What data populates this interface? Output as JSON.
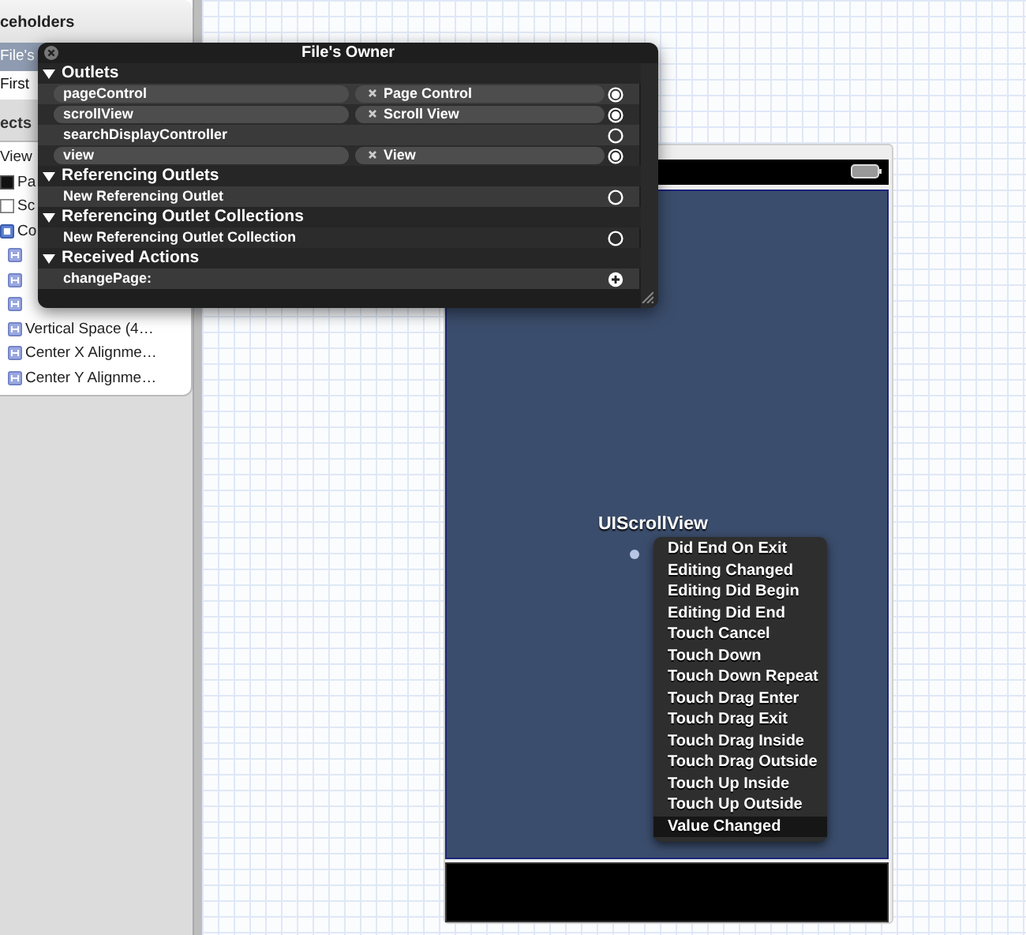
{
  "sidebar": {
    "placeholders_header": "ceholders",
    "placeholders": [
      {
        "label": "File's",
        "selected": true
      },
      {
        "label": "First",
        "selected": false
      }
    ],
    "objects_header": "ects",
    "objects": [
      {
        "label": "View",
        "children": [
          {
            "label": "Pa",
            "kind": "dark"
          },
          {
            "label": "Sc",
            "kind": "light"
          },
          {
            "label": "Co",
            "kind": "group",
            "children": [
              {
                "kind": "constraint"
              },
              {
                "kind": "constraint"
              },
              {
                "kind": "constraint"
              },
              {
                "label": "Vertical Space (4…",
                "kind": "constraint"
              },
              {
                "label": "Center X Alignme…",
                "kind": "constraint"
              },
              {
                "label": "Center Y Alignme…",
                "kind": "constraint"
              }
            ]
          }
        ]
      }
    ]
  },
  "popup": {
    "title": "File's Owner",
    "sections": [
      {
        "title": "Outlets",
        "expanded": true,
        "rows": [
          {
            "name": "pageControl",
            "target": "Page Control",
            "kind": "outlet",
            "connected": true
          },
          {
            "name": "scrollView",
            "target": "Scroll View",
            "kind": "outlet",
            "connected": true
          },
          {
            "name": "searchDisplayController",
            "kind": "outlet",
            "connected": false
          },
          {
            "name": "view",
            "target": "View",
            "kind": "outlet",
            "connected": true
          }
        ]
      },
      {
        "title": "Referencing Outlets",
        "expanded": true,
        "rows": [
          {
            "name": "New Referencing Outlet",
            "kind": "outlet",
            "connected": false
          }
        ]
      },
      {
        "title": "Referencing Outlet Collections",
        "expanded": true,
        "rows": [
          {
            "name": "New Referencing Outlet Collection",
            "kind": "outlet",
            "connected": false
          }
        ]
      },
      {
        "title": "Received Actions",
        "expanded": true,
        "rows": [
          {
            "name": "changePage:",
            "kind": "action"
          }
        ]
      }
    ]
  },
  "canvas": {
    "view_label": "UIScrollView",
    "events": [
      {
        "label": "Did End On Exit",
        "selected": false
      },
      {
        "label": "Editing Changed",
        "selected": false
      },
      {
        "label": "Editing Did Begin",
        "selected": false
      },
      {
        "label": "Editing Did End",
        "selected": false
      },
      {
        "label": "Touch Cancel",
        "selected": false
      },
      {
        "label": "Touch Down",
        "selected": false
      },
      {
        "label": "Touch Down Repeat",
        "selected": false
      },
      {
        "label": "Touch Drag Enter",
        "selected": false
      },
      {
        "label": "Touch Drag Exit",
        "selected": false
      },
      {
        "label": "Touch Drag Inside",
        "selected": false
      },
      {
        "label": "Touch Drag Outside",
        "selected": false
      },
      {
        "label": "Touch Up Inside",
        "selected": false
      },
      {
        "label": "Touch Up Outside",
        "selected": false
      },
      {
        "label": "Value Changed",
        "selected": true
      }
    ]
  }
}
